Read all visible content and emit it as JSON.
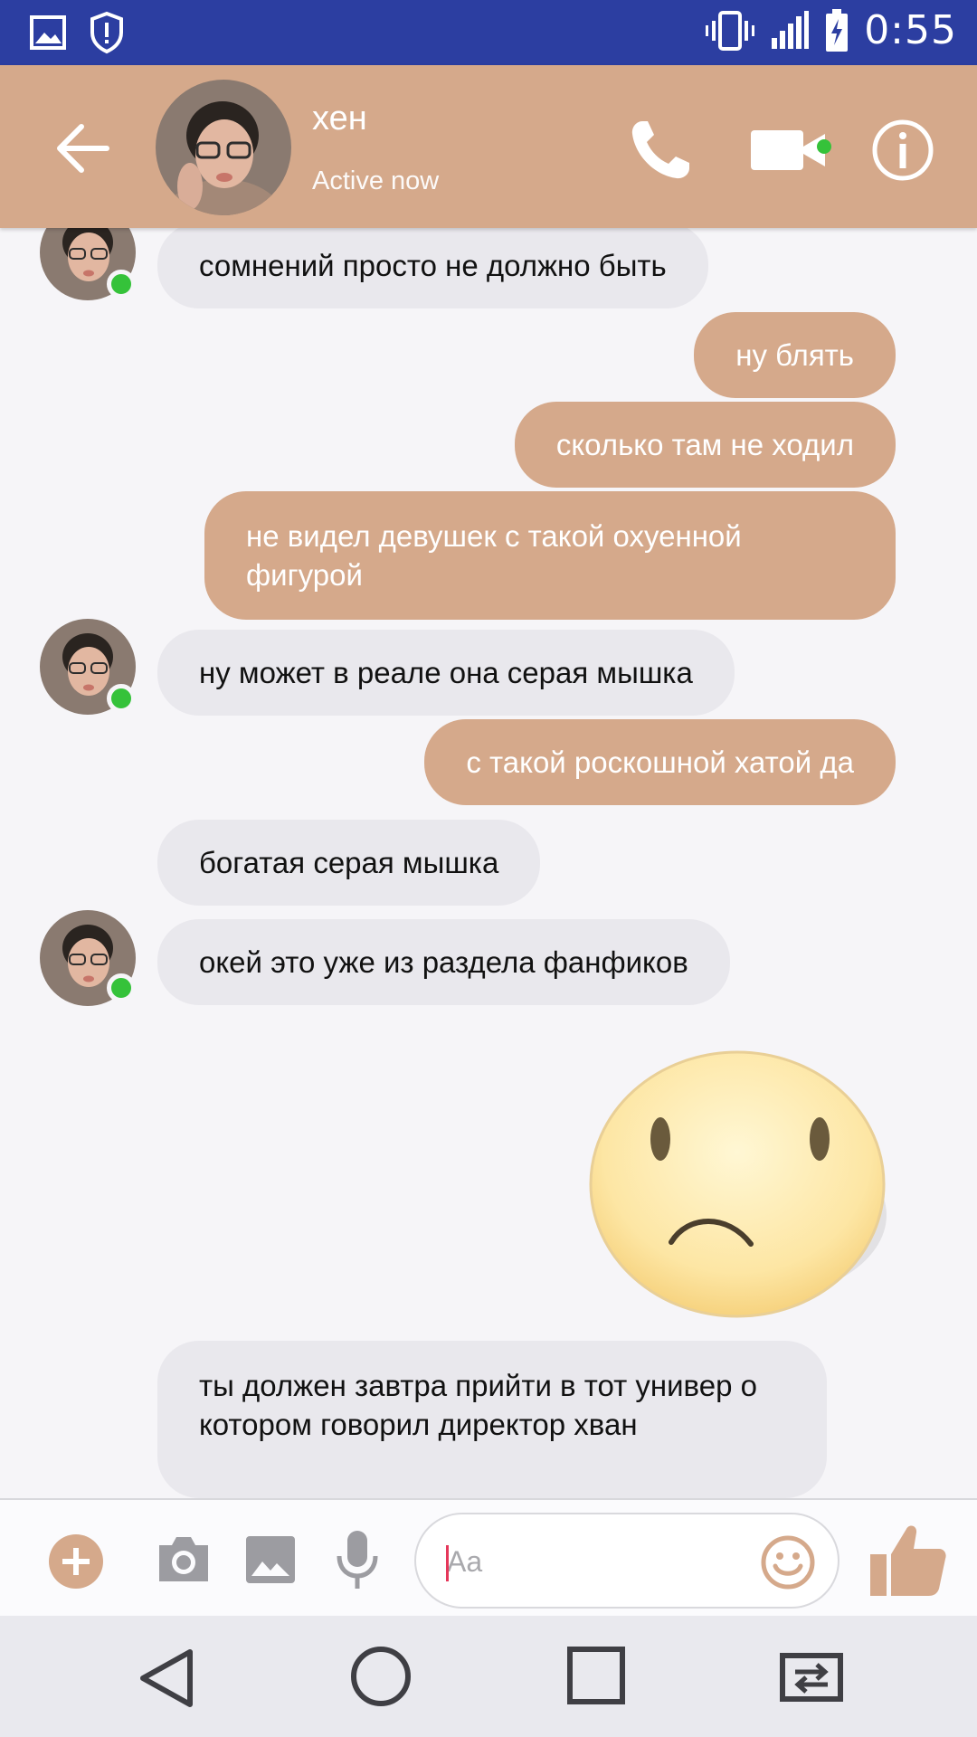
{
  "status_bar": {
    "time": "0:55",
    "icons": [
      "gallery-icon",
      "shield-alert-icon",
      "vibrate-icon",
      "signal-icon",
      "battery-charging-icon"
    ]
  },
  "header": {
    "contact_name": "хен",
    "status": "Active now",
    "accent_color": "#d5a98b",
    "online_color": "#35c23a"
  },
  "messages": [
    {
      "side": "in",
      "text": "сомнений просто не должно быть"
    },
    {
      "side": "out",
      "text": "ну блять"
    },
    {
      "side": "out",
      "text": "сколько там не ходил"
    },
    {
      "side": "out",
      "text": "не видел девушек с такой охуенной фигурой"
    },
    {
      "side": "in",
      "text": "ну может в реале она серая мышка"
    },
    {
      "side": "out",
      "text": "с такой роскошной хатой да"
    },
    {
      "side": "in",
      "text": "богатая серая мышка"
    },
    {
      "side": "in",
      "text": "окей это уже из раздела фанфиков"
    },
    {
      "side": "out",
      "sticker": "sad-face-sticker"
    },
    {
      "side": "in",
      "text": "ты должен завтра прийти в тот универ о котором говорил директор хван"
    }
  ],
  "composer": {
    "placeholder": "Aa",
    "value": ""
  },
  "navbar": {
    "buttons": [
      "back-icon",
      "home-icon",
      "recents-icon",
      "switch-app-icon"
    ]
  }
}
